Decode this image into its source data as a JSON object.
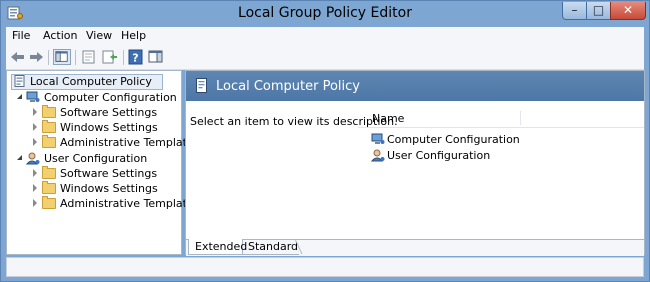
{
  "window": {
    "title": "Local Group Policy Editor",
    "buttons": {
      "minimize": "–",
      "maximize": "□",
      "close": "✕"
    }
  },
  "menu": [
    "File",
    "Action",
    "View",
    "Help"
  ],
  "toolbar": {
    "icons": [
      "back-arrow-icon",
      "forward-arrow-icon",
      "show-hide-console-tree-icon",
      "properties-icon",
      "export-list-icon",
      "help-icon",
      "show-hide-action-pane-icon"
    ]
  },
  "tree": {
    "root": "Local Computer Policy",
    "computer": {
      "label": "Computer Configuration",
      "children": [
        "Software Settings",
        "Windows Settings",
        "Administrative Templates"
      ]
    },
    "user": {
      "label": "User Configuration",
      "children": [
        "Software Settings",
        "Windows Settings",
        "Administrative Templates"
      ]
    }
  },
  "main": {
    "title": "Local Computer Policy",
    "description": "Select an item to view its description.",
    "column_header": "Name",
    "items": [
      "Computer Configuration",
      "User Configuration"
    ],
    "tabs": [
      "Extended",
      "Standard"
    ],
    "active_tab": "Extended"
  },
  "colors": {
    "frame": "#7da7d2",
    "header_band": "#5e86b3",
    "close_button": "#c74a37",
    "folder": "#f3d06f"
  }
}
